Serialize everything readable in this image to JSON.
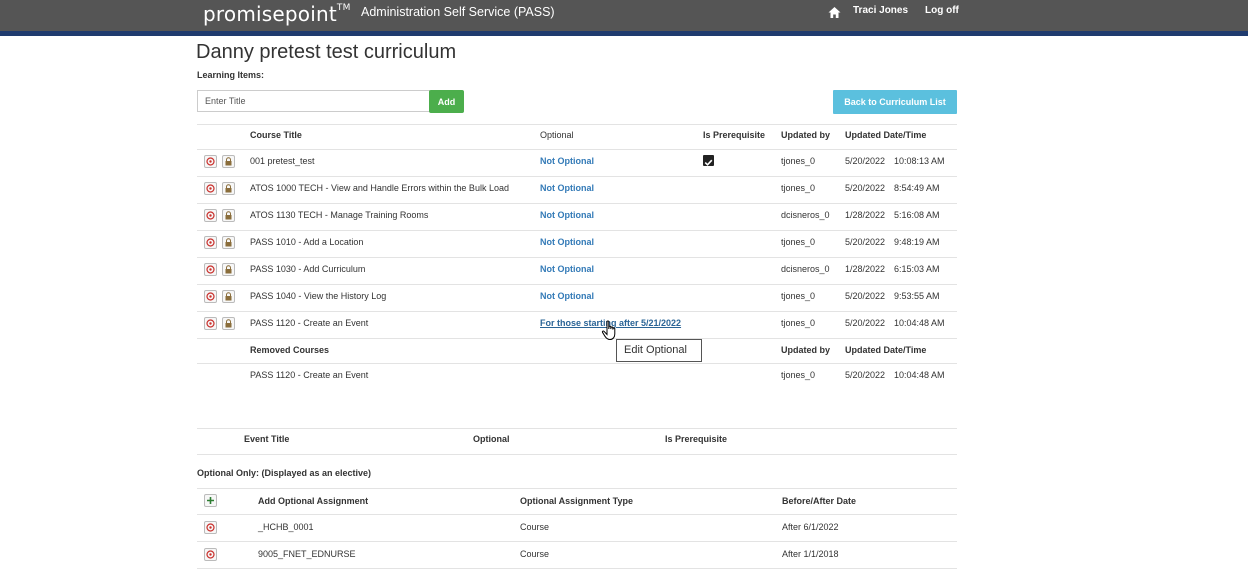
{
  "header": {
    "logo": "promisepoint",
    "logo_tm": "TM",
    "app_title": "Administration Self Service (PASS)",
    "user_name": "Traci Jones",
    "logoff_label": "Log off"
  },
  "page": {
    "title": "Danny pretest test curriculum",
    "learning_items_label": "Learning Items:",
    "title_input_placeholder": "Enter Title",
    "add_label": "Add",
    "back_label": "Back to Curriculum List"
  },
  "courses_table": {
    "headers": [
      "Course Title",
      "Optional",
      "Is Prerequisite",
      "Updated by",
      "Updated Date/Time"
    ],
    "rows": [
      {
        "title": "001 pretest_test",
        "optional": "Not Optional",
        "prereq": true,
        "updated_by": "tjones_0",
        "date": "5/20/2022",
        "time": "10:08:13 AM"
      },
      {
        "title": "ATOS 1000 TECH - View and Handle Errors within the Bulk Load",
        "optional": "Not Optional",
        "prereq": false,
        "updated_by": "tjones_0",
        "date": "5/20/2022",
        "time": "8:54:49 AM"
      },
      {
        "title": "ATOS 1130 TECH - Manage Training Rooms",
        "optional": "Not Optional",
        "prereq": false,
        "updated_by": "dcisneros_0",
        "date": "1/28/2022",
        "time": "5:16:08 AM"
      },
      {
        "title": "PASS 1010 - Add a Location",
        "optional": "Not Optional",
        "prereq": false,
        "updated_by": "tjones_0",
        "date": "5/20/2022",
        "time": "9:48:19 AM"
      },
      {
        "title": "PASS 1030 - Add Curriculum",
        "optional": "Not Optional",
        "prereq": false,
        "updated_by": "dcisneros_0",
        "date": "1/28/2022",
        "time": "6:15:03 AM"
      },
      {
        "title": "PASS 1040 - View the History Log",
        "optional": "Not Optional",
        "prereq": false,
        "updated_by": "tjones_0",
        "date": "5/20/2022",
        "time": "9:53:55 AM"
      },
      {
        "title": "PASS 1120 - Create an Event",
        "optional": "For those starting after 5/21/2022",
        "prereq": false,
        "updated_by": "tjones_0",
        "date": "5/20/2022",
        "time": "10:04:48 AM"
      }
    ],
    "tooltip": "Edit Optional"
  },
  "removed_table": {
    "headers": [
      "Removed Courses",
      "Updated by",
      "Updated Date/Time"
    ],
    "rows": [
      {
        "title": "PASS 1120 - Create an Event",
        "updated_by": "tjones_0",
        "date": "5/20/2022",
        "time": "10:04:48 AM"
      }
    ]
  },
  "events_table": {
    "headers": [
      "Event Title",
      "Optional",
      "Is Prerequisite"
    ]
  },
  "optional_only": {
    "label": "Optional Only: (Displayed as an elective)",
    "headers": [
      "Add Optional Assignment",
      "Optional Assignment Type",
      "Before/After Date"
    ],
    "rows": [
      {
        "name": "_HCHB_0001",
        "type": "Course",
        "date": "After 6/1/2022"
      },
      {
        "name": "9005_FNET_EDNURSE",
        "type": "Course",
        "date": "After 1/1/2018"
      }
    ]
  },
  "colors": {
    "header_bg": "#555555",
    "header_accent": "#1f3b6e",
    "add_button": "#4cae4c",
    "back_button": "#5bc0de",
    "link": "#337ab7"
  },
  "icons": [
    "home-icon",
    "remove-icon",
    "lock-icon",
    "checkbox-checked-icon",
    "plus-icon",
    "hand-cursor-icon"
  ]
}
